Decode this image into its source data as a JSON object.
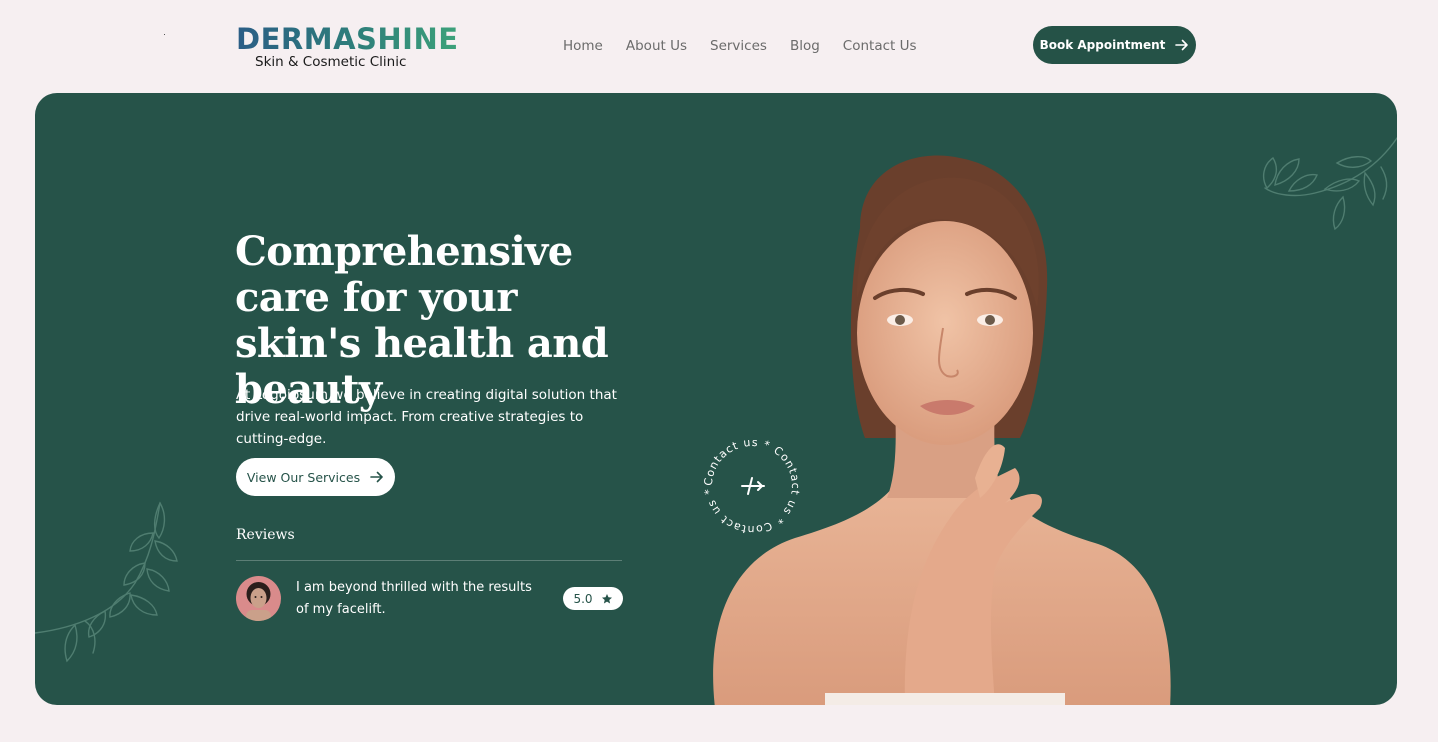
{
  "brand": {
    "name": "DERMASHINE",
    "tagline": "Skin & Cosmetic Clinic"
  },
  "nav": {
    "items": [
      {
        "label": "Home"
      },
      {
        "label": "About Us"
      },
      {
        "label": "Services"
      },
      {
        "label": "Blog"
      },
      {
        "label": "Contact Us"
      }
    ],
    "cta_label": "Book Appointment"
  },
  "hero": {
    "headline": "Comprehensive care for your skin's health and beauty",
    "intro": "At Logoipsum we believe in creating digital solution that drive real-world impact. From creative strategies to cutting-edge.",
    "cta_label": "View Our Services",
    "contact_badge_text": "Contact us * Contact us * Contact us *"
  },
  "reviews": {
    "title": "Reviews",
    "items": [
      {
        "text": "I am beyond thrilled with the results of my facelift.",
        "rating": "5.0"
      }
    ]
  },
  "colors": {
    "hero_bg": "#265349",
    "page_bg": "#f6eff1",
    "accent": "#255247"
  }
}
